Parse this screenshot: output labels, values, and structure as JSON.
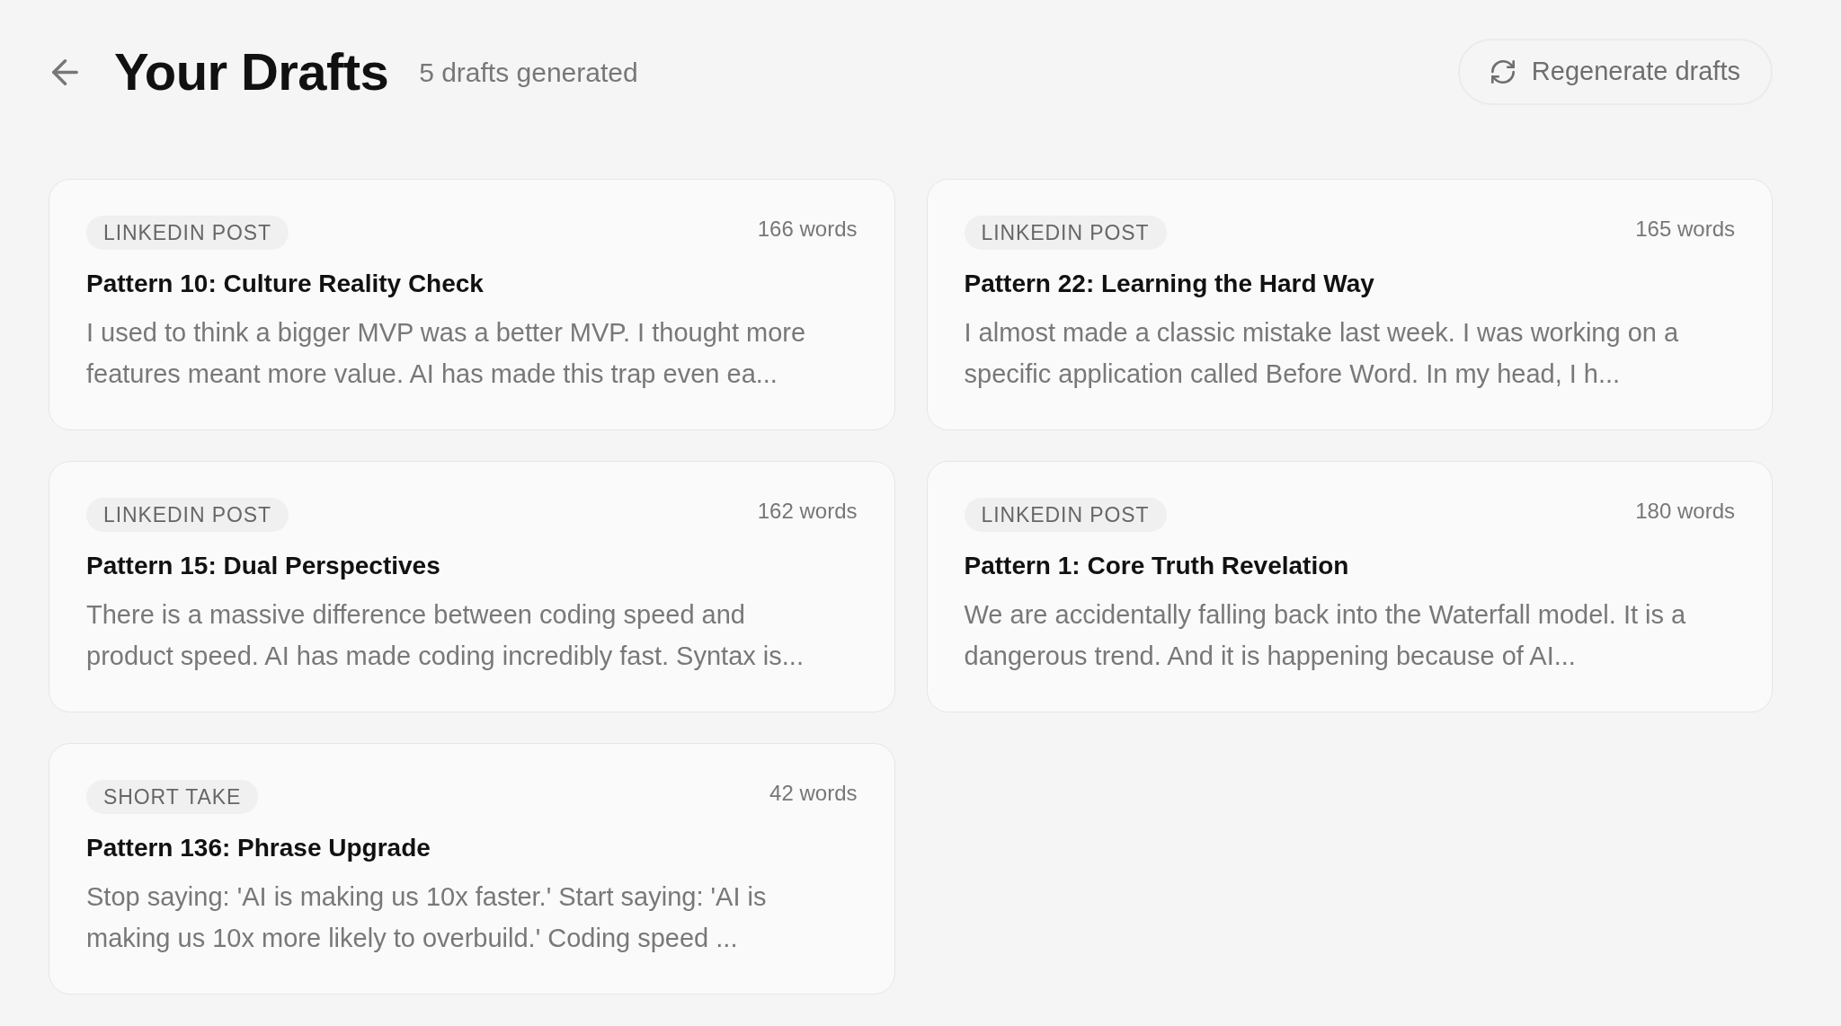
{
  "header": {
    "title": "Your Drafts",
    "count": "5 drafts generated",
    "regenerate_button": "Regenerate drafts"
  },
  "drafts": [
    {
      "type": "LINKEDIN POST",
      "word_count": "166 words",
      "title": "Pattern 10: Culture Reality Check",
      "excerpt": "I used to think a bigger MVP was a better MVP. I thought more features meant more value. AI has made this trap even ea..."
    },
    {
      "type": "LINKEDIN POST",
      "word_count": "165 words",
      "title": "Pattern 22: Learning the Hard Way",
      "excerpt": "I almost made a classic mistake last week. I was working on a specific application called Before Word. In my head, I h..."
    },
    {
      "type": "LINKEDIN POST",
      "word_count": "162 words",
      "title": "Pattern 15: Dual Perspectives",
      "excerpt": "There is a massive difference between coding speed and product speed. AI has made coding incredibly fast. Syntax is..."
    },
    {
      "type": "LINKEDIN POST",
      "word_count": "180 words",
      "title": "Pattern 1: Core Truth Revelation",
      "excerpt": "We are accidentally falling back into the Waterfall model. It is a dangerous trend. And it is happening because of AI..."
    },
    {
      "type": "SHORT TAKE",
      "word_count": "42 words",
      "title": "Pattern 136: Phrase Upgrade",
      "excerpt": "Stop saying: 'AI is making us 10x faster.' Start saying: 'AI is making us 10x more likely to overbuild.' Coding speed ..."
    }
  ]
}
